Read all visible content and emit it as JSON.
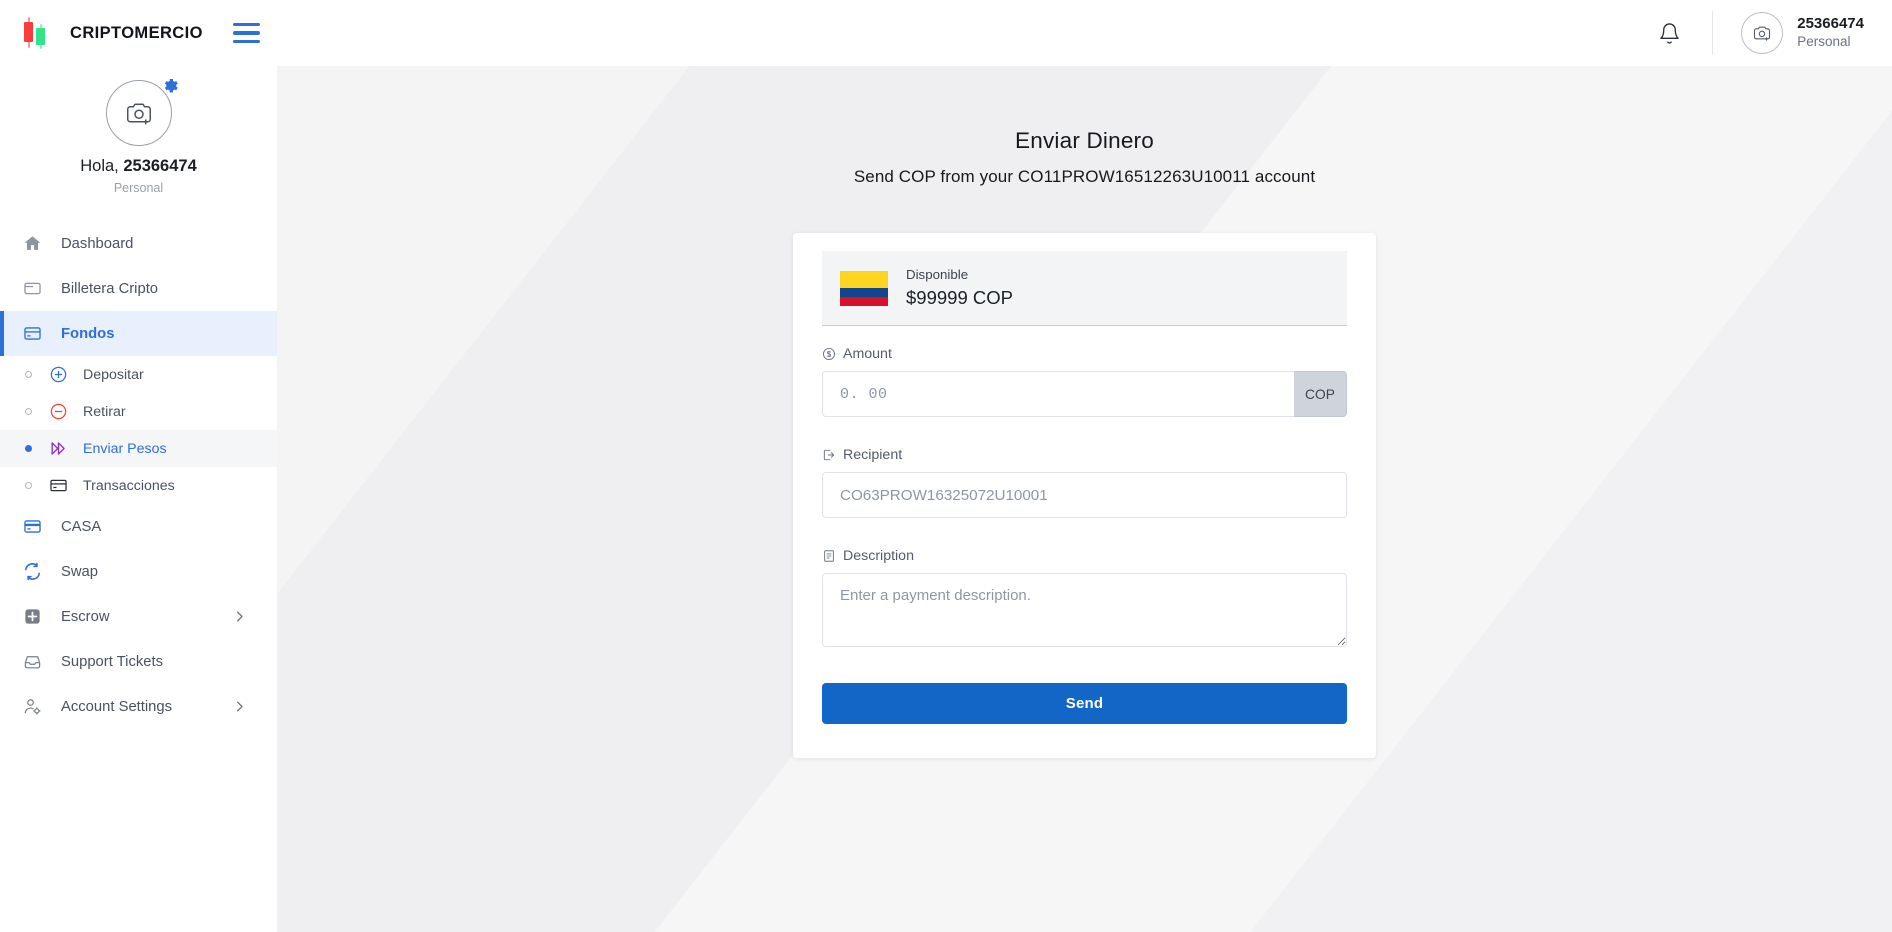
{
  "header": {
    "brand": "CRIPTOMERCIO",
    "logo_icon": "candlestick-logo",
    "menu_icon": "hamburger-menu-icon",
    "notifications_icon": "bell-icon",
    "account": {
      "avatar_icon": "camera-add-icon",
      "id": "25366474",
      "type": "Personal"
    }
  },
  "sidebar": {
    "profile": {
      "avatar_icon": "camera-add-icon",
      "settings_badge_icon": "gear-icon",
      "greeting_prefix": "Hola, ",
      "user_id": "25366474",
      "account_type": "Personal"
    },
    "items": [
      {
        "label": "Dashboard",
        "icon": "home-icon",
        "active": false,
        "expandable": false
      },
      {
        "label": "Billetera Cripto",
        "icon": "wallet-icon",
        "active": false,
        "expandable": false
      },
      {
        "label": "Fondos",
        "icon": "credit-card-icon",
        "active": true,
        "expandable": false
      },
      {
        "label": "CASA",
        "icon": "credit-card-blue-icon",
        "active": false,
        "expandable": false
      },
      {
        "label": "Swap",
        "icon": "swap-arrows-icon",
        "active": false,
        "expandable": false
      },
      {
        "label": "Escrow",
        "icon": "plus-square-icon",
        "active": false,
        "expandable": true
      },
      {
        "label": "Support Tickets",
        "icon": "inbox-icon",
        "active": false,
        "expandable": false
      },
      {
        "label": "Account Settings",
        "icon": "user-gear-icon",
        "active": false,
        "expandable": true
      }
    ],
    "subitems": [
      {
        "label": "Depositar",
        "icon": "plus-circle-icon",
        "active": false
      },
      {
        "label": "Retirar",
        "icon": "minus-circle-icon",
        "active": false
      },
      {
        "label": "Enviar Pesos",
        "icon": "double-arrow-icon",
        "active": true
      },
      {
        "label": "Transacciones",
        "icon": "card-list-icon",
        "active": false
      }
    ],
    "chevron_icon": "chevron-right-icon"
  },
  "main": {
    "title": "Enviar Dinero",
    "subtitle": "Send COP from your CO11PROW16512263U10011 account",
    "balance": {
      "flag": "colombia-flag",
      "label": "Disponible",
      "amount": "$99999 COP"
    },
    "form": {
      "amount": {
        "label": "Amount",
        "label_icon": "dollar-circle-icon",
        "placeholder": "0. 00",
        "value": "",
        "currency_addon": "COP"
      },
      "recipient": {
        "label": "Recipient",
        "label_icon": "send-out-icon",
        "placeholder": "CO63PROW16325072U10001",
        "value": ""
      },
      "description": {
        "label": "Description",
        "label_icon": "document-icon",
        "placeholder": "Enter a payment description.",
        "value": ""
      },
      "submit_label": "Send"
    }
  },
  "colors": {
    "accent_blue": "#2f6fd8",
    "button_blue": "#1266c6",
    "active_bg": "#e8f0fd",
    "candle_red": "#fa3c3c",
    "candle_green": "#2ee58a",
    "flag_yellow": "#ffd520",
    "flag_blue": "#11458e",
    "flag_red": "#d6112c"
  }
}
